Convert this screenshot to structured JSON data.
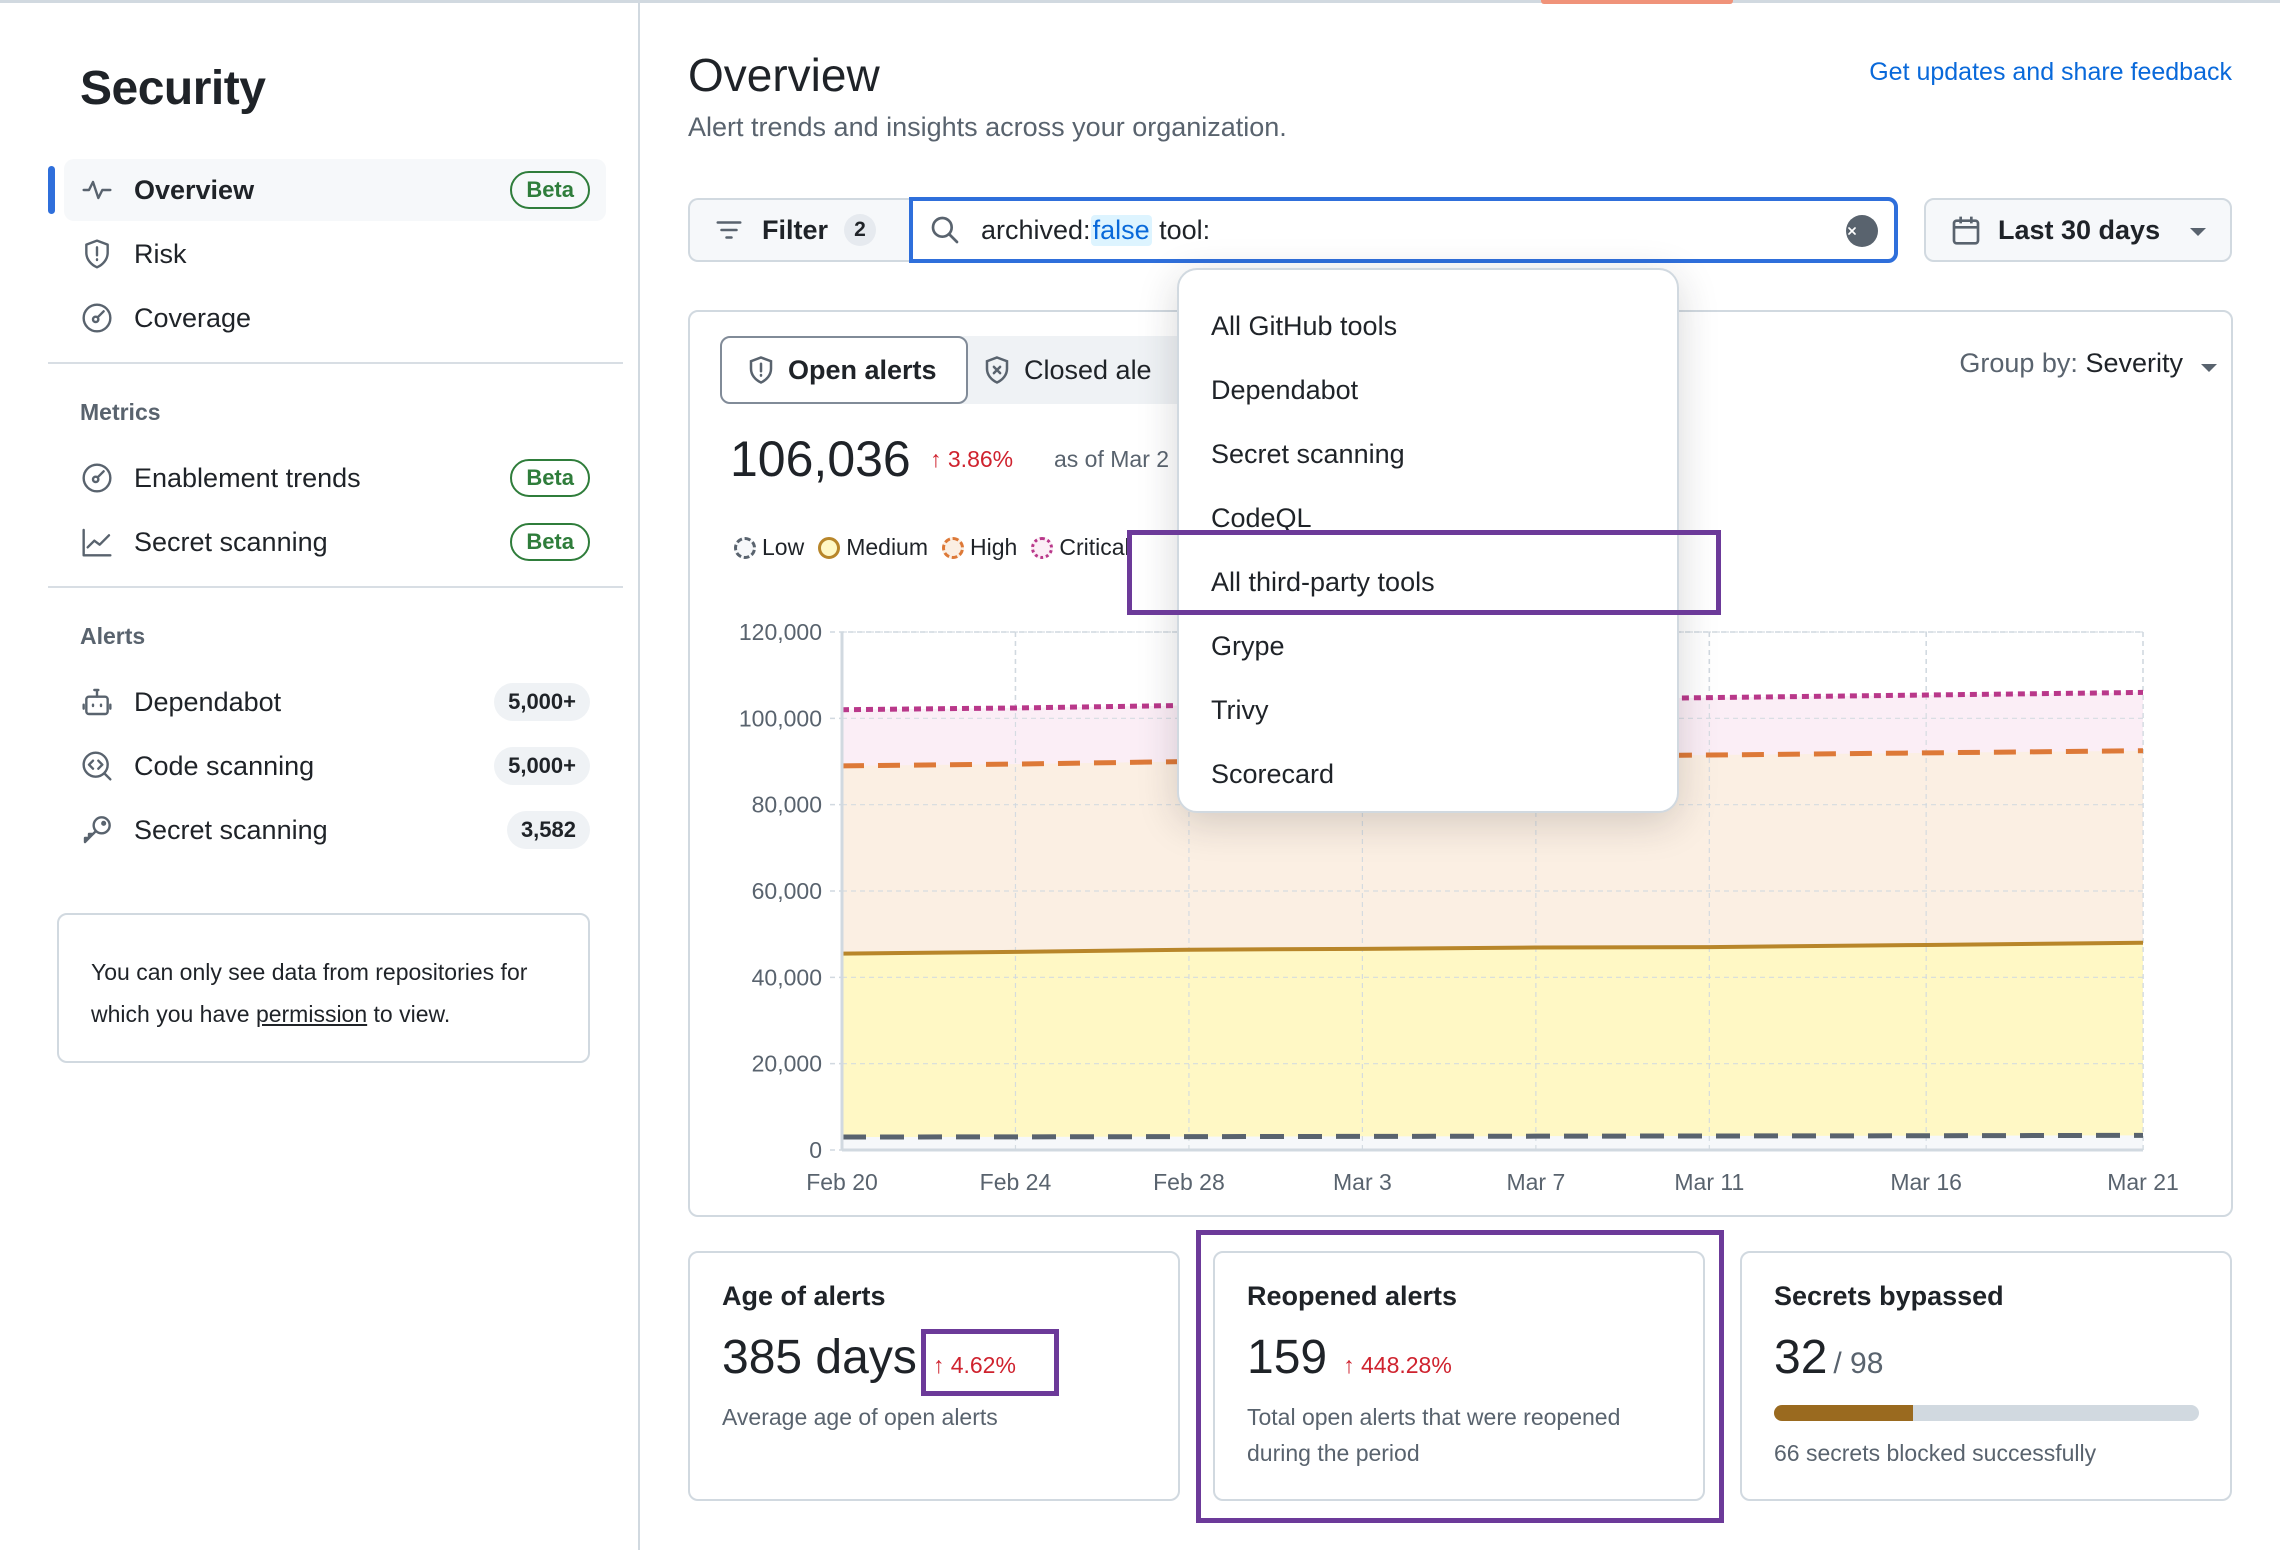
{
  "sidebar": {
    "title": "Security",
    "nav": [
      {
        "label": "Overview",
        "icon": "pulse-icon",
        "badge": "Beta",
        "active": true
      },
      {
        "label": "Risk",
        "icon": "shield-alert-icon"
      },
      {
        "label": "Coverage",
        "icon": "meter-icon"
      }
    ],
    "metrics_heading": "Metrics",
    "metrics": [
      {
        "label": "Enablement trends",
        "icon": "meter-icon",
        "badge": "Beta"
      },
      {
        "label": "Secret scanning",
        "icon": "graph-icon",
        "badge": "Beta"
      }
    ],
    "alerts_heading": "Alerts",
    "alerts": [
      {
        "label": "Dependabot",
        "icon": "dependabot-icon",
        "count": "5,000+"
      },
      {
        "label": "Code scanning",
        "icon": "code-scan-icon",
        "count": "5,000+"
      },
      {
        "label": "Secret scanning",
        "icon": "key-icon",
        "count": "3,582"
      }
    ],
    "notice_before": "You can only see data from repositories for which you have ",
    "notice_link": "permission",
    "notice_after": " to view."
  },
  "header": {
    "title": "Overview",
    "subtitle": "Alert trends and insights across your organization.",
    "feedback_link": "Get updates and share feedback"
  },
  "toolbar": {
    "filter_label": "Filter",
    "filter_count": "2",
    "query_key": "archived:",
    "query_value": "false",
    "query_rest": " tool:",
    "date_range": "Last 30 days"
  },
  "dropdown": {
    "items": [
      "All GitHub tools",
      "Dependabot",
      "Secret scanning",
      "CodeQL",
      "All third-party tools",
      "Grype",
      "Trivy",
      "Scorecard"
    ],
    "highlighted": "All third-party tools"
  },
  "chart_card": {
    "tabs": [
      {
        "label": "Open alerts",
        "active": true
      },
      {
        "label": "Closed ale",
        "active": false
      }
    ],
    "group_by_label": "Group by:",
    "group_by_value": "Severity",
    "total": "106,036",
    "trend": "↑ 3.86%",
    "as_of": "as of Mar 2"
  },
  "chart_data": {
    "type": "area",
    "title": "",
    "xlabel": "",
    "ylabel": "",
    "ylim": [
      0,
      120000
    ],
    "yticks": [
      "0",
      "20,000",
      "40,000",
      "60,000",
      "80,000",
      "100,000",
      "120,000"
    ],
    "ytick_values": [
      0,
      20000,
      40000,
      60000,
      80000,
      100000,
      120000
    ],
    "x": [
      "Feb 20",
      "Feb 24",
      "Feb 28",
      "Mar 3",
      "Mar 7",
      "Mar 11",
      "Mar 16",
      "Mar 21"
    ],
    "x_day_index": [
      0,
      4,
      8,
      12,
      16,
      20,
      25,
      30
    ],
    "grid": true,
    "stacked": true,
    "legend": "top-left",
    "series": [
      {
        "name": "Low",
        "color": "#59636e",
        "fill": "#f6f8fa",
        "cumulative_values": [
          3000,
          3050,
          3100,
          3150,
          3200,
          3250,
          3300,
          3400
        ]
      },
      {
        "name": "Medium",
        "color": "#b8862a",
        "fill": "#fff8c5",
        "cumulative_values": [
          45500,
          45900,
          46400,
          46600,
          46900,
          47000,
          47500,
          48000
        ]
      },
      {
        "name": "High",
        "color": "#dd7938",
        "fill": "#fbefe3",
        "cumulative_values": [
          89000,
          89400,
          90000,
          90500,
          91200,
          91500,
          92000,
          92500
        ]
      },
      {
        "name": "Critical",
        "color": "#b9388a",
        "fill": "#fbeef6",
        "cumulative_values": [
          102000,
          102400,
          103000,
          103600,
          104300,
          104800,
          105400,
          106000
        ]
      }
    ]
  },
  "stats": [
    {
      "title": "Age of alerts",
      "value": "385 days",
      "trend": "↑ 4.62%",
      "desc": "Average age of open alerts"
    },
    {
      "title": "Reopened alerts",
      "value": "159",
      "trend": "↑ 448.28%",
      "desc": "Total open alerts that were reopened during the period"
    },
    {
      "title": "Secrets bypassed",
      "value": "32",
      "denominator": "/ 98",
      "progress_fraction": 0.3265,
      "desc": "66 secrets blocked successfully"
    }
  ]
}
